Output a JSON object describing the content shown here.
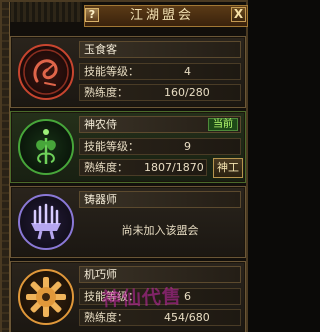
{
  "window": {
    "title": "江湖盟会",
    "help_label": "?",
    "close_label": "X"
  },
  "guilds": [
    {
      "name": "玉食客",
      "level_label": "技能等级：",
      "level_value": "4",
      "proficiency_label": "熟练度：",
      "proficiency_value": "160/280",
      "emblem_icon": "dragon-emblem-icon",
      "accent": "#c8452f"
    },
    {
      "name": "神农侍",
      "status": "当前",
      "level_label": "技能等级：",
      "level_value": "9",
      "proficiency_label": "熟练度：",
      "proficiency_value": "1807/1870",
      "action_label": "神工",
      "emblem_icon": "herb-emblem-icon",
      "accent": "#47a63a"
    },
    {
      "name": "铸器师",
      "notice": "尚未加入该盟会",
      "emblem_icon": "forge-emblem-icon",
      "accent": "#8a78d6"
    },
    {
      "name": "机巧师",
      "level_label": "技能等级：",
      "level_value": "6",
      "proficiency_label": "熟练度：",
      "proficiency_value": "454/680",
      "emblem_icon": "gear-emblem-icon",
      "accent": "#e0983a"
    }
  ],
  "watermark_text": "神仙代售"
}
